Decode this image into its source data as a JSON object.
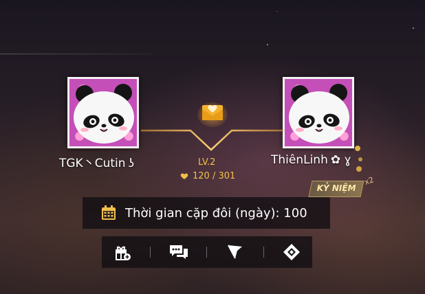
{
  "left_player": {
    "name": "TGK丶Cutin",
    "suffix": "ʖ"
  },
  "right_player": {
    "name": "ThiênLinh",
    "suffix": "✿ ɣ"
  },
  "couple": {
    "level": "LV.2",
    "points": "120 / 301"
  },
  "memorial_badge": "KỶ NIỆM",
  "multiplier": "x2",
  "duration_text": "Thời gian cặp đôi (ngày): 100",
  "actions": [
    {
      "icon": "gift-icon"
    },
    {
      "icon": "chat-icon"
    },
    {
      "icon": "flag-icon"
    },
    {
      "icon": "diamond-icon"
    }
  ],
  "colors": {
    "accent_gold": "#f2c04a",
    "line_orange": "#ffb13c"
  }
}
